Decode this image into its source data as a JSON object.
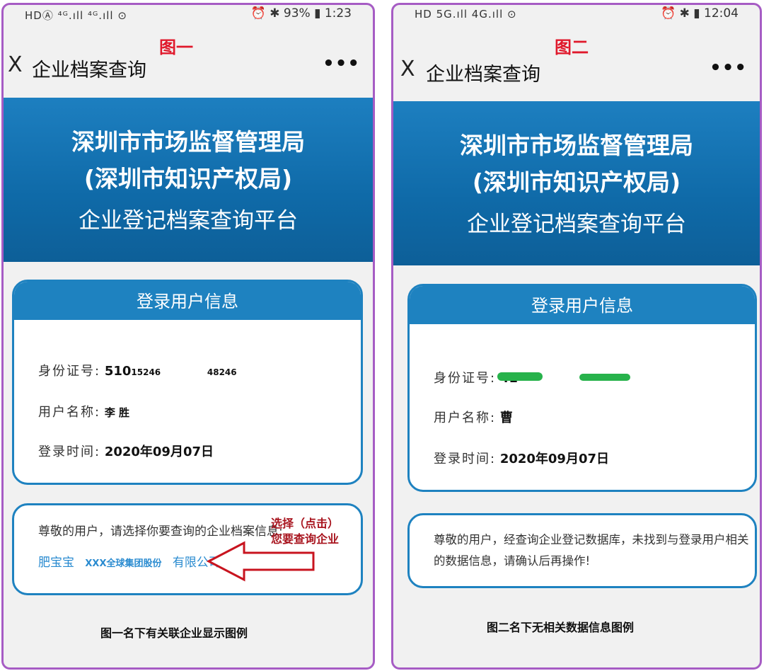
{
  "panel1": {
    "status_left": "HDⒶ ⁴ᴳ.ıll ⁴ᴳ.ıll ⊙",
    "status_right": "⏰ ✱ 93% ▮ 1:23",
    "figure_label": "图一",
    "app_title": "企业档案查询",
    "close_icon_text": "X",
    "more_icon_text": "•••",
    "banner": {
      "line1": "深圳市市场监督管理局",
      "line2": "(深圳市知识产权局)",
      "line3": "企业登记档案查询平台"
    },
    "user_card": {
      "header": "登录用户信息",
      "id_label": "身份证号:",
      "id_value_prefix": "510",
      "id_value_mid": "15246",
      "id_value_suffix": "48246",
      "name_label": "用户名称:",
      "name_value": "李 胜",
      "time_label": "登录时间:",
      "time_value": "2020年09月07日"
    },
    "company_card": {
      "message": "尊敬的用户，请选择你要查询的企业档案信息:",
      "link_parts": [
        "肥宝宝",
        "XXX全球集团股份",
        "有限公司"
      ]
    },
    "callout": {
      "line1": "选择（点击）",
      "line2": "您要查询企业"
    },
    "caption": "图一名下有关联企业显示图例"
  },
  "panel2": {
    "status_left": "HD 5G.ıll 4G.ıll ⊙",
    "status_right": "⏰ ✱ ▮ 12:04",
    "figure_label": "图二",
    "app_title": "企业档案查询",
    "close_icon_text": "X",
    "more_icon_text": "•••",
    "banner": {
      "line1": "深圳市市场监督管理局",
      "line2": "(深圳市知识产权局)",
      "line3": "企业登记档案查询平台"
    },
    "user_card": {
      "header": "登录用户信息",
      "id_label": "身份证号:",
      "id_value_prefix": "41",
      "name_label": "用户名称:",
      "name_value": "曹",
      "time_label": "登录时间:",
      "time_value": "2020年09月07日"
    },
    "notice_card": {
      "message_line1": "尊敬的用户，经查询企业登记数据库，未找到与登录用户相关",
      "message_line2": "的数据信息，请确认后再操作!"
    },
    "caption": "图二名下无相关数据信息图例"
  },
  "colors": {
    "frame": "#a65cc4",
    "brand_blue": "#1e82c0",
    "figure_label_red": "#e0182b",
    "callout_red": "#a8141e",
    "link_blue": "#2a8bd0"
  },
  "icons": [
    "close-icon",
    "more-icon",
    "arrow-icon",
    "signal-icon",
    "wifi-icon",
    "battery-icon",
    "alarm-icon",
    "bluetooth-icon"
  ]
}
